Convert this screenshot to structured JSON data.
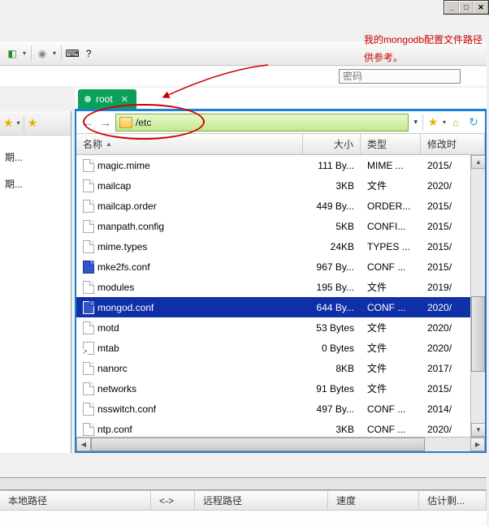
{
  "annotation": {
    "line1": "我的mongodb配置文件路径",
    "line2": "供参考。"
  },
  "password_placeholder": "密码",
  "tab": {
    "label": "root",
    "close": "✕"
  },
  "address": "/etc",
  "left_items": [
    "",
    "期...",
    "",
    "期..."
  ],
  "columns": {
    "name": "名称",
    "size": "大小",
    "type": "类型",
    "modified": "修改时"
  },
  "files": [
    {
      "name": "magic.mime",
      "size": "111 By...",
      "type": "MIME ...",
      "date": "2015/",
      "icon": "file"
    },
    {
      "name": "mailcap",
      "size": "3KB",
      "type": "文件",
      "date": "2020/",
      "icon": "file"
    },
    {
      "name": "mailcap.order",
      "size": "449 By...",
      "type": "ORDER...",
      "date": "2015/",
      "icon": "file"
    },
    {
      "name": "manpath.config",
      "size": "5KB",
      "type": "CONFI...",
      "date": "2015/",
      "icon": "file"
    },
    {
      "name": "mime.types",
      "size": "24KB",
      "type": "TYPES ...",
      "date": "2015/",
      "icon": "file"
    },
    {
      "name": "mke2fs.conf",
      "size": "967 By...",
      "type": "CONF ...",
      "date": "2015/",
      "icon": "dark"
    },
    {
      "name": "modules",
      "size": "195 By...",
      "type": "文件",
      "date": "2019/",
      "icon": "file"
    },
    {
      "name": "mongod.conf",
      "size": "644 By...",
      "type": "CONF ...",
      "date": "2020/",
      "icon": "dark",
      "selected": true
    },
    {
      "name": "motd",
      "size": "53 Bytes",
      "type": "文件",
      "date": "2020/",
      "icon": "file"
    },
    {
      "name": "mtab",
      "size": "0 Bytes",
      "type": "文件",
      "date": "2020/",
      "icon": "link"
    },
    {
      "name": "nanorc",
      "size": "8KB",
      "type": "文件",
      "date": "2017/",
      "icon": "file"
    },
    {
      "name": "networks",
      "size": "91 Bytes",
      "type": "文件",
      "date": "2015/",
      "icon": "file"
    },
    {
      "name": "nsswitch.conf",
      "size": "497 By...",
      "type": "CONF ...",
      "date": "2014/",
      "icon": "file"
    },
    {
      "name": "ntp.conf",
      "size": "3KB",
      "type": "CONF ...",
      "date": "2020/",
      "icon": "file"
    }
  ],
  "footer": {
    "local": "本地路径",
    "dir": "<->",
    "remote": "远程路径",
    "speed": "速度",
    "eta": "估计剩..."
  }
}
